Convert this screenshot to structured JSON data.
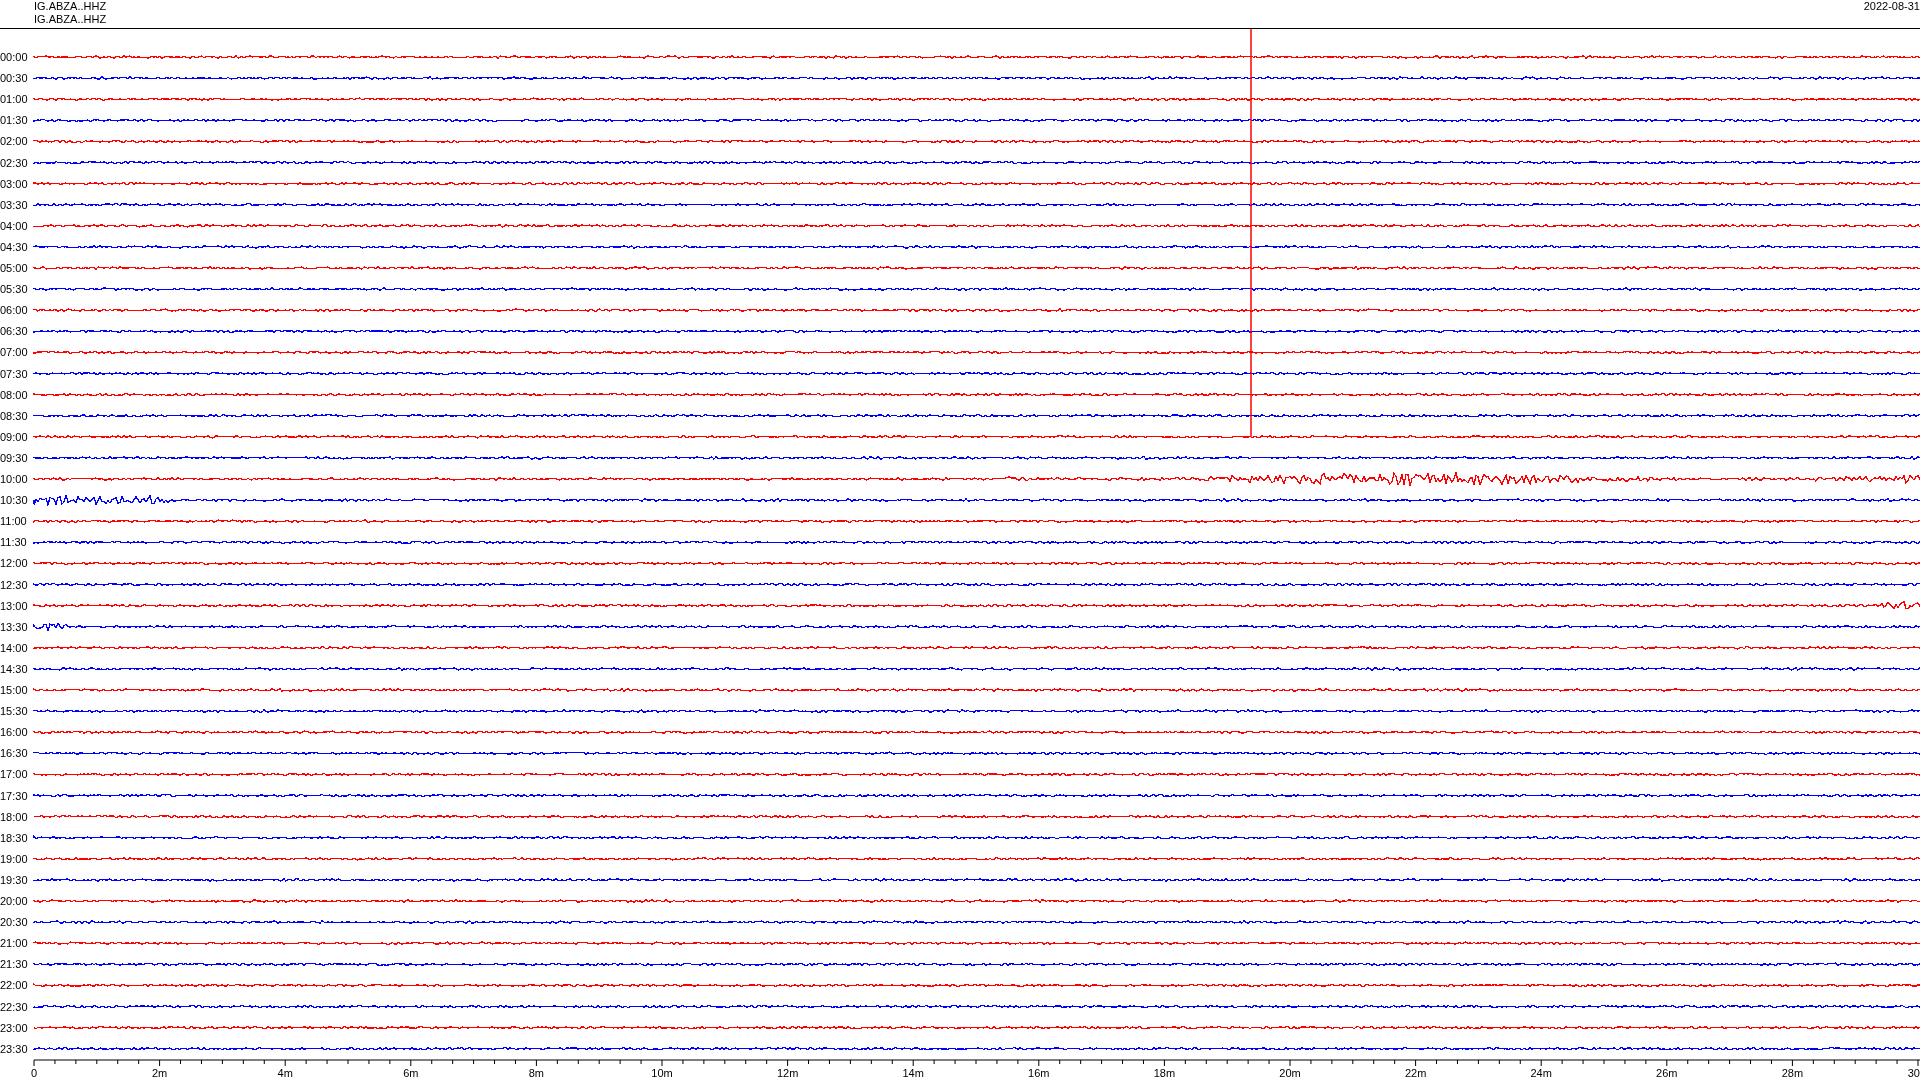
{
  "header": {
    "station_lines": [
      "IG.ABZA..HHZ",
      "IG.ABZA..HHZ"
    ],
    "date": "2022-08-31"
  },
  "traces": [
    {
      "time": "00:00",
      "color": "#ff0000"
    },
    {
      "time": "00:30",
      "color": "#0000ff"
    },
    {
      "time": "01:00",
      "color": "#ff0000"
    },
    {
      "time": "01:30",
      "color": "#0000ff"
    },
    {
      "time": "02:00",
      "color": "#ff0000"
    },
    {
      "time": "02:30",
      "color": "#0000ff"
    },
    {
      "time": "03:00",
      "color": "#ff0000"
    },
    {
      "time": "03:30",
      "color": "#0000ff"
    },
    {
      "time": "04:00",
      "color": "#ff0000"
    },
    {
      "time": "04:30",
      "color": "#0000ff"
    },
    {
      "time": "05:00",
      "color": "#ff0000"
    },
    {
      "time": "05:30",
      "color": "#0000ff"
    },
    {
      "time": "06:00",
      "color": "#ff0000"
    },
    {
      "time": "06:30",
      "color": "#0000ff"
    },
    {
      "time": "07:00",
      "color": "#ff0000"
    },
    {
      "time": "07:30",
      "color": "#0000ff"
    },
    {
      "time": "08:00",
      "color": "#ff0000"
    },
    {
      "time": "08:30",
      "color": "#0000ff"
    },
    {
      "time": "09:00",
      "color": "#ff0000"
    },
    {
      "time": "09:30",
      "color": "#0000ff"
    },
    {
      "time": "10:00",
      "color": "#ff0000"
    },
    {
      "time": "10:30",
      "color": "#0000ff"
    },
    {
      "time": "11:00",
      "color": "#ff0000"
    },
    {
      "time": "11:30",
      "color": "#0000ff"
    },
    {
      "time": "12:00",
      "color": "#ff0000"
    },
    {
      "time": "12:30",
      "color": "#0000ff"
    },
    {
      "time": "13:00",
      "color": "#ff0000"
    },
    {
      "time": "13:30",
      "color": "#0000ff"
    },
    {
      "time": "14:00",
      "color": "#ff0000"
    },
    {
      "time": "14:30",
      "color": "#0000ff"
    },
    {
      "time": "15:00",
      "color": "#ff0000"
    },
    {
      "time": "15:30",
      "color": "#0000ff"
    },
    {
      "time": "16:00",
      "color": "#ff0000"
    },
    {
      "time": "16:30",
      "color": "#0000ff"
    },
    {
      "time": "17:00",
      "color": "#ff0000"
    },
    {
      "time": "17:30",
      "color": "#0000ff"
    },
    {
      "time": "18:00",
      "color": "#ff0000"
    },
    {
      "time": "18:30",
      "color": "#0000ff"
    },
    {
      "time": "19:00",
      "color": "#ff0000"
    },
    {
      "time": "19:30",
      "color": "#0000ff"
    },
    {
      "time": "20:00",
      "color": "#ff0000"
    },
    {
      "time": "20:30",
      "color": "#0000ff"
    },
    {
      "time": "21:00",
      "color": "#ff0000"
    },
    {
      "time": "21:30",
      "color": "#0000ff"
    },
    {
      "time": "22:00",
      "color": "#ff0000"
    },
    {
      "time": "22:30",
      "color": "#0000ff"
    },
    {
      "time": "23:00",
      "color": "#ff0000"
    },
    {
      "time": "23:30",
      "color": "#0000ff"
    }
  ],
  "x_axis": {
    "labels": [
      "0",
      "2m",
      "4m",
      "6m",
      "8m",
      "10m",
      "12m",
      "14m",
      "16m",
      "18m",
      "20m",
      "22m",
      "24m",
      "26m",
      "28m",
      "30"
    ]
  }
}
